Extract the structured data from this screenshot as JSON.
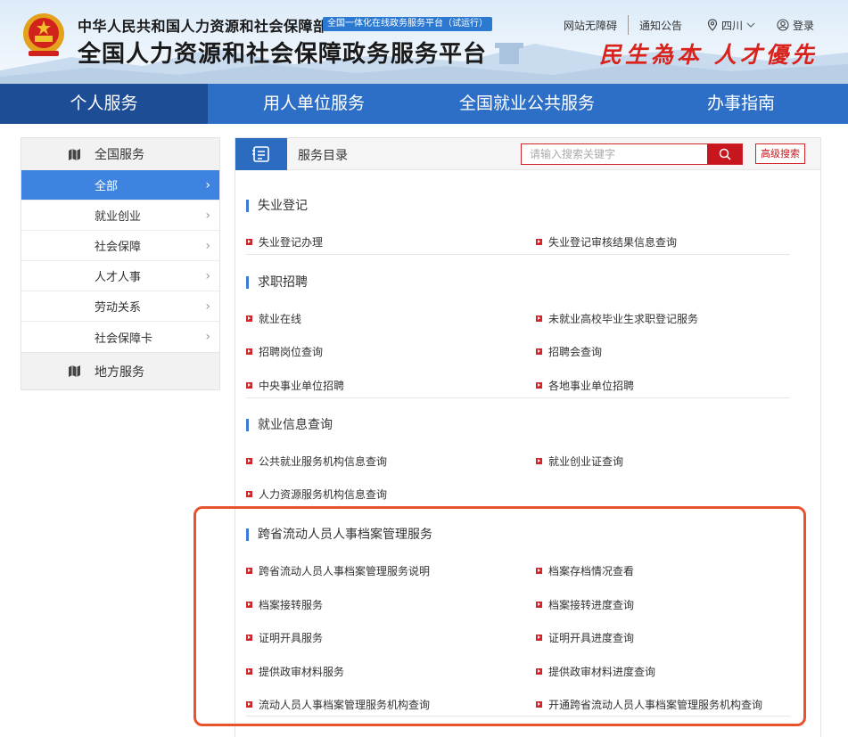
{
  "header": {
    "ministry": "中华人民共和国人力资源和社会保障部",
    "badge": "全国一体化在线政务服务平台（试运行）",
    "platform": "全国人力资源和社会保障政务服务平台",
    "slogan": "民生為本  人才優先",
    "links": {
      "accessibility": "网站无障碍",
      "notice": "通知公告",
      "region": "四川",
      "login": "登录"
    }
  },
  "nav": [
    "个人服务",
    "用人单位服务",
    "全国就业公共服务",
    "办事指南"
  ],
  "sidebar": {
    "national": "全国服务",
    "items": [
      "全部",
      "就业创业",
      "社会保障",
      "人才人事",
      "劳动关系",
      "社会保障卡"
    ],
    "local": "地方服务"
  },
  "main": {
    "title": "服务目录",
    "search_placeholder": "请输入搜索关键字",
    "advanced": "高级搜索",
    "sections": [
      {
        "title": "失业登记",
        "items": [
          "失业登记办理",
          "失业登记审核结果信息查询"
        ]
      },
      {
        "title": "求职招聘",
        "items": [
          "就业在线",
          "未就业高校毕业生求职登记服务",
          "招聘岗位查询",
          "招聘会查询",
          "中央事业单位招聘",
          "各地事业单位招聘"
        ]
      },
      {
        "title": "就业信息查询",
        "items": [
          "公共就业服务机构信息查询",
          "就业创业证查询",
          "人力资源服务机构信息查询"
        ]
      },
      {
        "title": "跨省流动人员人事档案管理服务",
        "items": [
          "跨省流动人员人事档案管理服务说明",
          "档案存档情况查看",
          "档案接转服务",
          "档案接转进度查询",
          "证明开具服务",
          "证明开具进度查询",
          "提供政审材料服务",
          "提供政审材料进度查询",
          "流动人员人事档案管理服务机构查询",
          "开通跨省流动人员人事档案管理服务机构查询"
        ]
      }
    ]
  },
  "colors": {
    "nav": "#2d6fc6",
    "nav_active": "#1d4d95",
    "accent_red": "#d0262b",
    "sidebar_active": "#3f83e0",
    "highlight": "#e8522c"
  }
}
